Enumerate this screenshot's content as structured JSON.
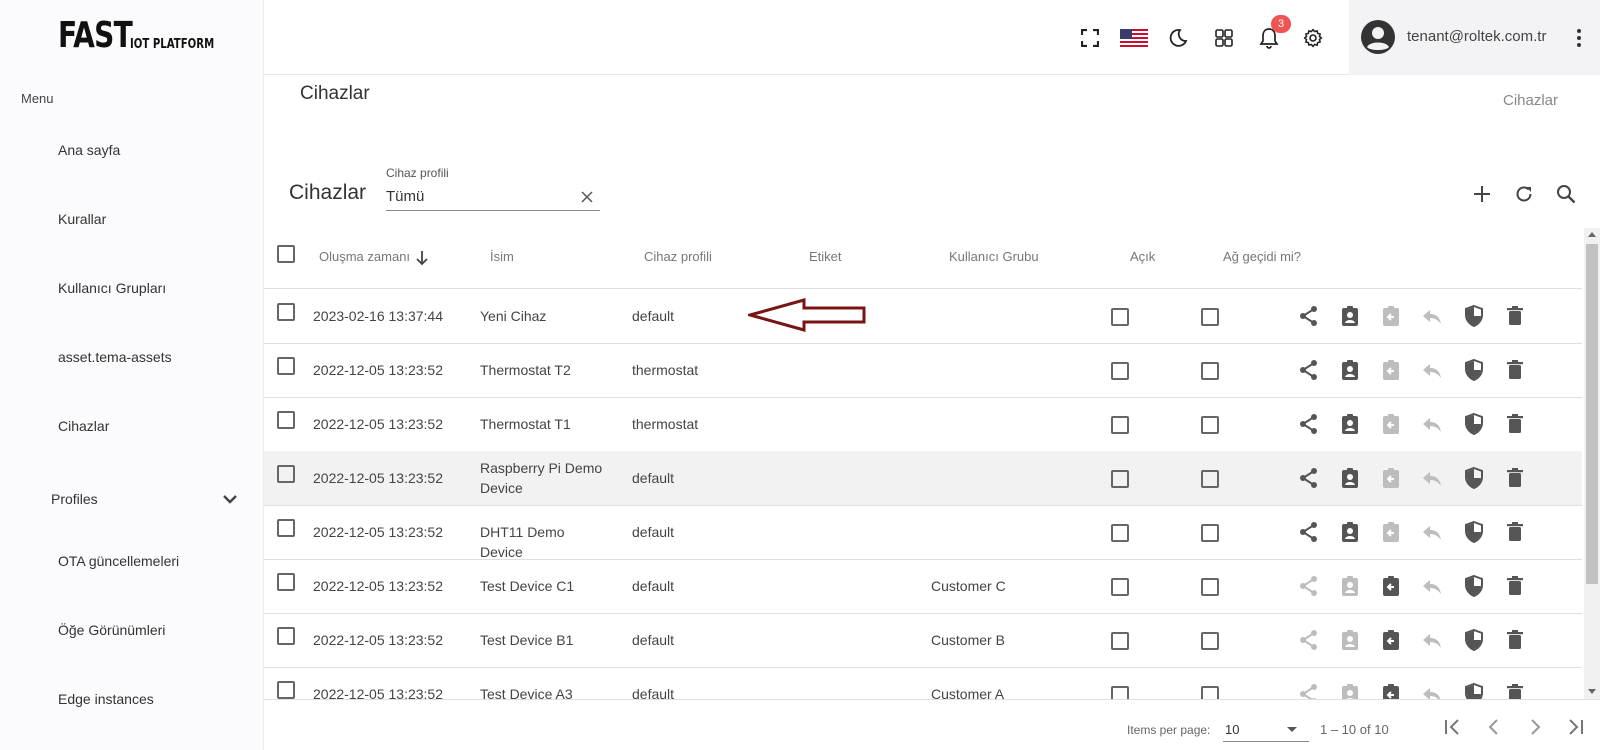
{
  "logo": {
    "big": "FAST",
    "small": "IOT PLATFORM"
  },
  "sidebar": {
    "menu_label": "Menu",
    "items": [
      {
        "label": "Ana sayfa"
      },
      {
        "label": "Kurallar"
      },
      {
        "label": "Kullanıcı Grupları"
      },
      {
        "label": "asset.tema-assets"
      },
      {
        "label": "Cihazlar"
      },
      {
        "label": "Profiles"
      },
      {
        "label": "OTA güncellemeleri"
      },
      {
        "label": "Öğe Görünümleri"
      },
      {
        "label": "Edge instances"
      }
    ]
  },
  "header": {
    "notification_count": "3",
    "user_email": "tenant@roltek.com.tr",
    "icons": [
      "fullscreen-icon",
      "us-flag-icon",
      "moon-icon",
      "grid-icon",
      "bell-icon",
      "gear-icon",
      "account-circle-icon",
      "kebab-menu-icon"
    ]
  },
  "page": {
    "title": "Cihazlar",
    "breadcrumb": "Cihazlar"
  },
  "card": {
    "title": "Cihazlar",
    "filter_label": "Cihaz profili",
    "filter_value": "Tümü"
  },
  "table": {
    "columns": [
      "Oluşma zamanı",
      "İsim",
      "Cihaz profili",
      "Etiket",
      "Kullanıcı Grubu",
      "Açık",
      "Ağ geçidi mi?"
    ],
    "rows": [
      {
        "created": "2023-02-16 13:37:44",
        "name": "Yeni Cihaz",
        "profile": "default",
        "label": "",
        "group": "",
        "assigned": false
      },
      {
        "created": "2022-12-05 13:23:52",
        "name": "Thermostat T2",
        "profile": "thermostat",
        "label": "",
        "group": "",
        "assigned": false
      },
      {
        "created": "2022-12-05 13:23:52",
        "name": "Thermostat T1",
        "profile": "thermostat",
        "label": "",
        "group": "",
        "assigned": false
      },
      {
        "created": "2022-12-05 13:23:52",
        "name": "Raspberry Pi Demo Device",
        "profile": "default",
        "label": "",
        "group": "",
        "assigned": false
      },
      {
        "created": "2022-12-05 13:23:52",
        "name": "DHT11 Demo Device",
        "profile": "default",
        "label": "",
        "group": "",
        "assigned": false
      },
      {
        "created": "2022-12-05 13:23:52",
        "name": "Test Device C1",
        "profile": "default",
        "label": "",
        "group": "Customer C",
        "assigned": true
      },
      {
        "created": "2022-12-05 13:23:52",
        "name": "Test Device B1",
        "profile": "default",
        "label": "",
        "group": "Customer B",
        "assigned": true
      },
      {
        "created": "2022-12-05 13:23:52",
        "name": "Test Device A3",
        "profile": "default",
        "label": "",
        "group": "Customer A",
        "assigned": true
      }
    ],
    "row_actions": [
      "share-icon",
      "assign-icon",
      "unassign-icon",
      "reply-icon",
      "security-shield-icon",
      "delete-icon"
    ]
  },
  "paginator": {
    "items_per_page_label": "Items per page:",
    "page_size": "10",
    "range_label": "1 – 10 of 10"
  },
  "colors": {
    "icon_active": "#555555",
    "icon_disabled": "#bdbdbd",
    "badge": "#f05454",
    "annotation_arrow": "#7a1414"
  }
}
